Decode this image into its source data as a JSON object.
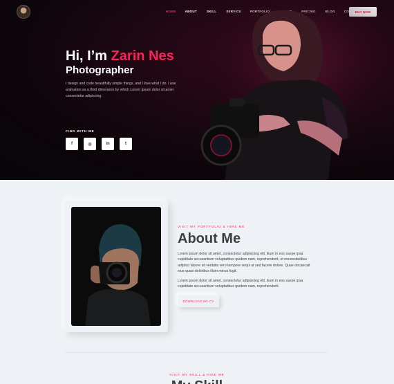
{
  "nav": {
    "items": [
      {
        "label": "HOME",
        "active": true
      },
      {
        "label": "ABOUT"
      },
      {
        "label": "SKILL"
      },
      {
        "label": "SERVICE"
      },
      {
        "label": "PORTFOLIO"
      },
      {
        "label": "CLIENT"
      },
      {
        "label": "PRICING"
      },
      {
        "label": "BLOG"
      },
      {
        "label": "CONTACT"
      }
    ],
    "buy_label": "BUY NOW"
  },
  "hero": {
    "greeting": "Hi, I’m ",
    "name": "Zarin Nes",
    "role": "Photographer",
    "description": "I design and code beautifully simple things, and I love what I do. I use animation as a third dimension by which Lorem ipsum dolor sit amet consectetur adipiscing.",
    "find_label": "FIND WITH ME",
    "socials": [
      {
        "icon": "facebook-icon",
        "glyph": "f"
      },
      {
        "icon": "instagram-icon",
        "glyph": "◎"
      },
      {
        "icon": "linkedin-icon",
        "glyph": "in"
      },
      {
        "icon": "twitter-icon",
        "glyph": "t"
      }
    ]
  },
  "about": {
    "eyebrow": "VISIT MY PORTFOLIO & HIRE ME",
    "title": "About Me",
    "para1": "Lorem ipsum dolor sit amet, consectetur adipisicing elit. Eum in eos saepe ipsa cupiditate accusantium voluptatibus quidem nam, reprehenderit, et necessitatibus adipisci labore sit veritatis vero tempore sequi at sed facere dolore. Quae obcaecati eius quasi doloribus illum minus fugit.",
    "para2": "Lorem ipsum dolor sit amet, consectetur adipisicing elit. Eum in eos saepe ipsa cupiditate accusantium voluptatibus quidem nam, reprehenderit.",
    "cv_label": "DOWNLOAD MY CV"
  },
  "skill": {
    "eyebrow": "VISIT MY SKILL & HIRE ME",
    "title": "My Skill"
  },
  "colors": {
    "accent": "#ff1f5a",
    "hero_bg": "#0c050a",
    "page_bg": "#eef1f5"
  }
}
